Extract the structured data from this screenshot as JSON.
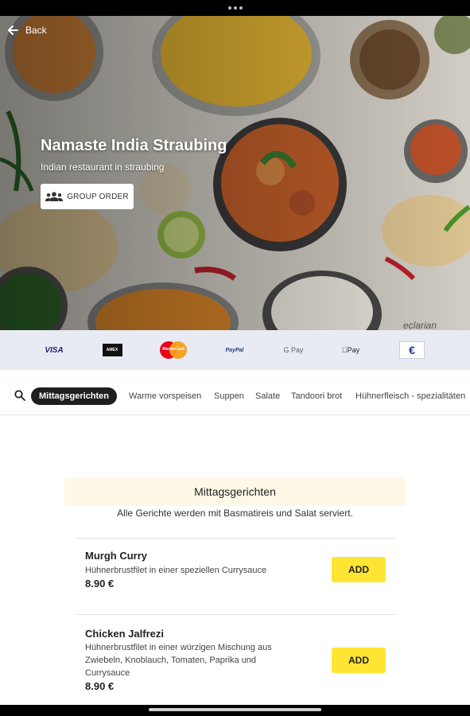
{
  "hero": {
    "back_label": "Back",
    "title": "Namaste India Straubing",
    "subtitle": "Indian restaurant in straubing",
    "group_order_label": "GROUP ORDER",
    "watermark": "eclarian"
  },
  "payments": {
    "methods": [
      {
        "name": "visa-icon",
        "label": "VISA"
      },
      {
        "name": "amex-icon",
        "label": "AMEX"
      },
      {
        "name": "mastercard-icon",
        "label": "MasterCard"
      },
      {
        "name": "paypal-icon",
        "label": "PayPal"
      },
      {
        "name": "google-pay-icon",
        "label": "G Pay"
      },
      {
        "name": "apple-pay-icon",
        "label": "Pay"
      },
      {
        "name": "euro-cash-icon",
        "label": "€"
      }
    ]
  },
  "categories": {
    "items": [
      "Mittagsgerichten",
      "Warme vorspeisen",
      "Suppen",
      "Salate",
      "Tandoori brot",
      "Hühnerfleisch - spezialitäten"
    ],
    "active_index": 0
  },
  "section": {
    "title": "Mittagsgerichten",
    "description": "Alle Gerichte werden mit Basmatireis und Salat serviert."
  },
  "menu_items": [
    {
      "name": "Murgh Curry",
      "description": "Hühnerbrustfilet in einer speziellen Currysauce",
      "price": "8.90 €",
      "add_label": "ADD"
    },
    {
      "name": "Chicken Jalfrezi",
      "description": "Hühnerbrustfilet in einer würzigen Mischung aus Zwiebeln, Knoblauch, Tomaten, Paprika und Currysauce",
      "price": "8.90 €",
      "add_label": "ADD"
    }
  ],
  "colors": {
    "accent_yellow": "#ffe533",
    "section_bg": "#fdf9e6",
    "payment_bar_bg": "#e8ebf1",
    "active_chip": "#1f1f1f"
  }
}
